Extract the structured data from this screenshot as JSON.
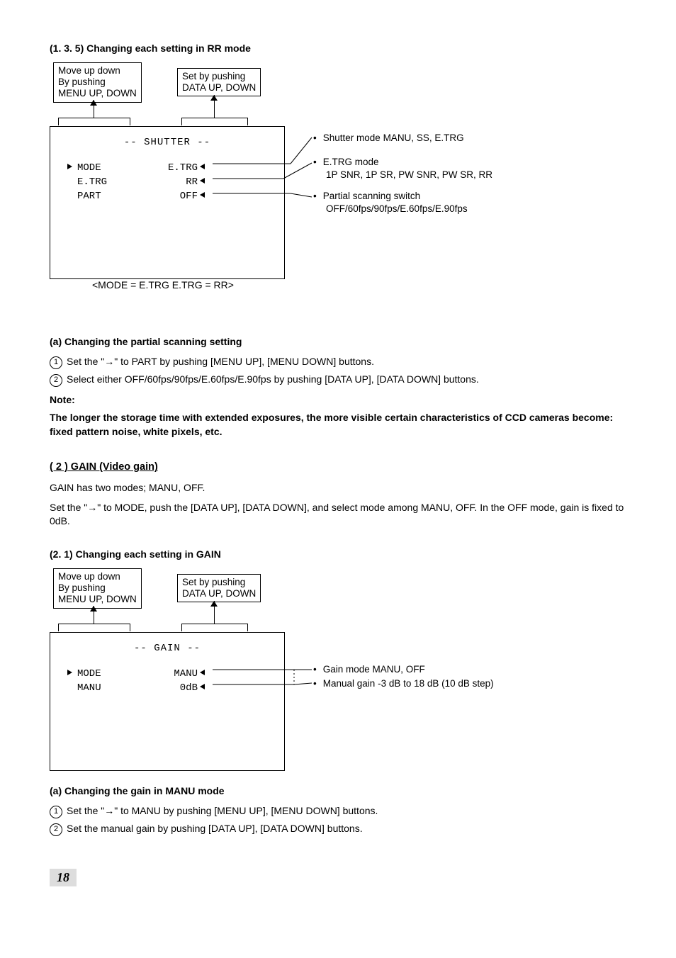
{
  "sec135": {
    "title": "(1. 3. 5)   Changing each setting in RR mode",
    "hintLeft": "Move up down\nBy pushing\nMENU UP, DOWN",
    "hintRight": "Set by pushing\nDATA UP, DOWN",
    "menu": {
      "title": "-- SHUTTER --",
      "rows": [
        {
          "arrow": "→",
          "label": "MODE",
          "value": "E.TRG"
        },
        {
          "arrow": "",
          "label": "E.TRG",
          "value": "RR"
        },
        {
          "arrow": "",
          "label": "PART",
          "value": "OFF"
        }
      ]
    },
    "callout1": "Shutter mode   MANU, SS, E.TRG",
    "callout2a": "E.TRG mode",
    "callout2b": "1P SNR, 1P SR, PW SNR, PW SR, RR",
    "callout3a": "Partial scanning switch",
    "callout3b": "OFF/60fps/90fps/E.60fps/E.90fps",
    "caption": "<MODE = E.TRG   E.TRG = RR>",
    "subA": "(a)  Changing the partial scanning setting",
    "step1": "Set the \"→\" to PART by pushing [MENU UP], [MENU DOWN] buttons.",
    "step2": "Select either OFF/60fps/90fps/E.60fps/E.90fps by pushing [DATA UP], [DATA DOWN] buttons.",
    "noteLabel": "Note:",
    "noteBody": "The longer the storage time with extended exposures, the more visible certain characteristics of CCD cameras become: fixed pattern noise, white pixels, etc."
  },
  "sec2": {
    "heading": "( 2 )   GAIN (Video gain)",
    "p1": "GAIN has two modes; MANU, OFF.",
    "p2": "Set the \"→\" to MODE, push the [DATA UP], [DATA DOWN], and select mode among MANU, OFF. In the OFF mode, gain is fixed to 0dB."
  },
  "sec21": {
    "title": "(2. 1)  Changing each setting in GAIN",
    "hintLeft": "Move up down\nBy pushing\nMENU UP, DOWN",
    "hintRight": "Set by pushing\nDATA UP, DOWN",
    "menu": {
      "title": "-- GAIN --",
      "rows": [
        {
          "arrow": "→",
          "label": "MODE",
          "value": "MANU"
        },
        {
          "arrow": "",
          "label": "MANU",
          "value": "0dB"
        }
      ]
    },
    "callout1": "Gain mode   MANU, OFF",
    "callout2": "Manual gain   -3 dB to 18 dB (10 dB step)",
    "subA": "(a)  Changing the gain in MANU mode",
    "step1": "Set the \"→\" to MANU by pushing [MENU UP], [MENU DOWN] buttons.",
    "step2": "Set the manual gain by pushing [DATA UP], [DATA DOWN] buttons."
  },
  "pageNumber": "18"
}
